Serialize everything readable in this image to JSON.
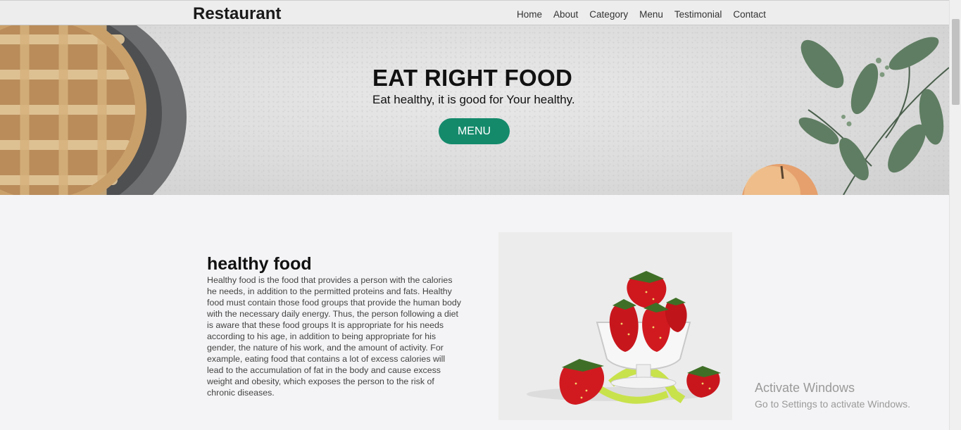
{
  "nav": {
    "brand": "Restaurant",
    "links": [
      "Home",
      "About",
      "Category",
      "Menu",
      "Testimonial",
      "Contact"
    ]
  },
  "hero": {
    "title": "EAT RIGHT FOOD",
    "subtitle": "Eat healthy, it is good for Your healthy.",
    "button_label": "MENU",
    "button_color": "#148a6b"
  },
  "section": {
    "title": "healthy food",
    "body": "Healthy food is the food that provides a person with the calories he needs, in addition to the permitted proteins and fats. Healthy food must contain those food groups that provide the human body with the necessary daily energy. Thus, the person following a diet is aware that these food groups It is appropriate for his needs according to his age, in addition to being appropriate for his gender, the nature of his work, and the amount of activity. For example, eating food that contains a lot of excess calories will lead to the accumulation of fat in the body and cause excess weight and obesity, which exposes the person to the risk of chronic diseases.",
    "image": "strawberries-in-glass-bowl"
  },
  "watermark": {
    "title": "Activate Windows",
    "subtitle": "Go to Settings to activate Windows."
  }
}
